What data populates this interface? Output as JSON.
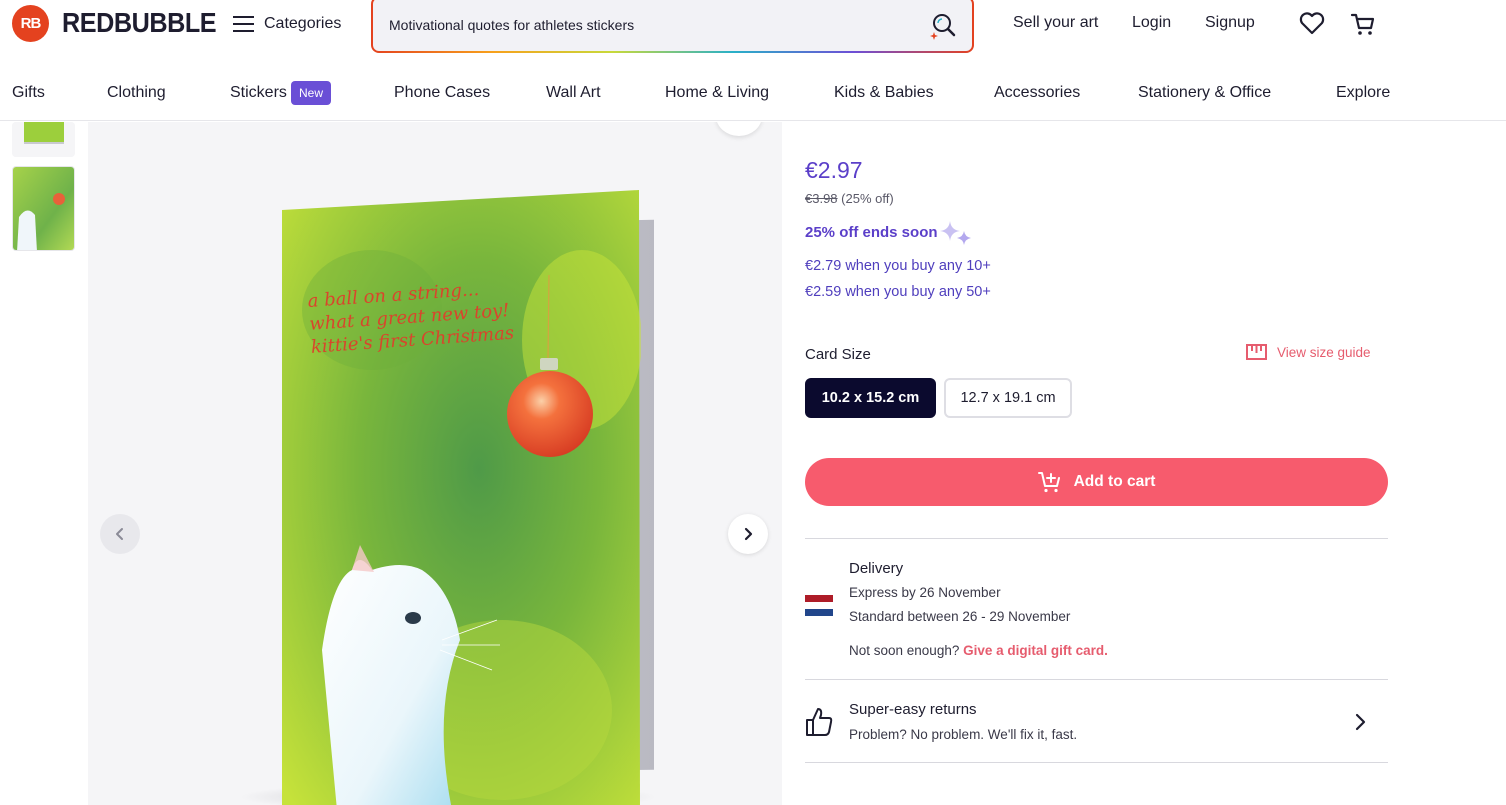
{
  "header": {
    "logo_badge": "RB",
    "logo_text": "REDBUBBLE",
    "categories_label": "Categories",
    "search_value": "Motivational quotes for athletes stickers",
    "sell": "Sell your art",
    "login": "Login",
    "signup": "Signup"
  },
  "catnav": {
    "items": [
      "Gifts",
      "Clothing",
      "Stickers",
      "Phone Cases",
      "Wall Art",
      "Home & Living",
      "Kids & Babies",
      "Accessories",
      "Stationery & Office",
      "Explore"
    ],
    "new_badge": "New"
  },
  "product": {
    "card_lines": [
      "a ball on a string...",
      "what a great new toy!",
      "kittie's first Christmas"
    ],
    "price": "€2.97",
    "original_price": "€3.98",
    "discount": " (25% off)",
    "sale_ends": "25% off ends soon",
    "bulk": [
      "€2.79 when you buy any 10+",
      "€2.59 when you buy any 50+"
    ],
    "size_label": "Card Size",
    "size_guide": "View size guide",
    "sizes": [
      "10.2 x 15.2 cm",
      "12.7 x 19.1 cm"
    ],
    "add_to_cart": "Add to cart"
  },
  "delivery": {
    "title": "Delivery",
    "express": "Express by 26 November",
    "standard": "Standard between 26 - 29 November",
    "not_soon": "Not soon enough? ",
    "gift_link": "Give a digital gift card."
  },
  "returns": {
    "title": "Super-easy returns",
    "subtitle": "Problem? No problem. We'll fix it, fast."
  },
  "colors": {
    "accent_purple": "#5b3fc9",
    "cart_button": "#f75b6d",
    "selected_size": "#0b0a2e",
    "link_red": "#e65c6e"
  }
}
